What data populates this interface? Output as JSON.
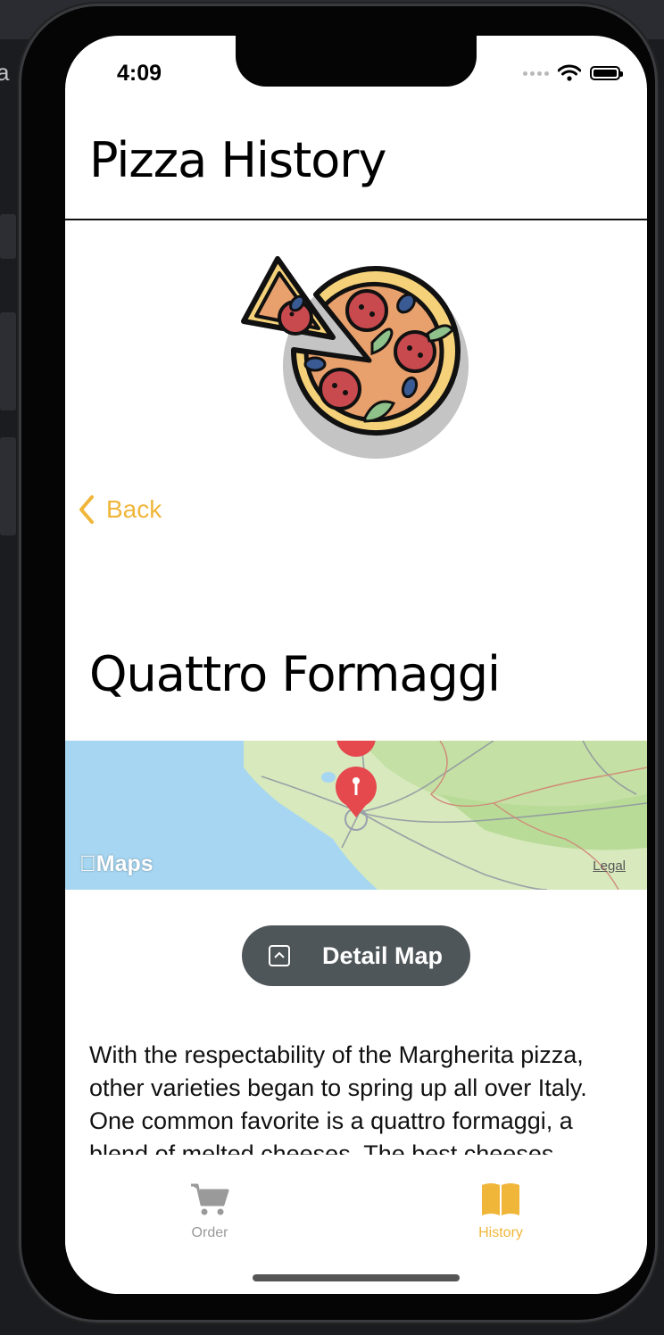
{
  "status_bar": {
    "time": "4:09"
  },
  "header": {
    "title": "Pizza History"
  },
  "nav": {
    "back_label": "Back"
  },
  "detail": {
    "title": "Quattro Formaggi",
    "map": {
      "brand": "Maps",
      "legal": "Legal"
    },
    "detail_map_label": "Detail Map",
    "description": "With the respectability of the Margherita pizza, other varieties began to spring up all over Italy. One common favorite is a quattro formaggi, a blend of melted cheeses. The best cheeses"
  },
  "tabs": [
    {
      "label": "Order",
      "icon": "cart-icon",
      "selected": false
    },
    {
      "label": "History",
      "icon": "book-icon",
      "selected": true
    }
  ],
  "colors": {
    "accent": "#f0b63a",
    "inactive_tab": "#9a9a9a",
    "map_button": "#4f5659",
    "map_sea": "#a6d6f1",
    "map_land": "#cfe6b2"
  }
}
